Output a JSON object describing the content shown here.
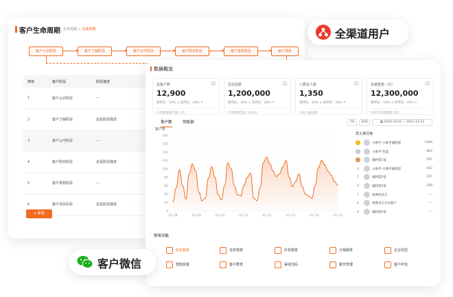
{
  "lifecycle": {
    "title": "客户生命周期",
    "breadcrumb_prefix": "生命周期 > ",
    "breadcrumb_current": "设置周期",
    "stages": [
      "客户认识阶段",
      "客户了解阶段",
      "客户认可阶段",
      "客户购买阶段",
      "客户复购阶段",
      "客户流失"
    ],
    "table_headers": [
      "排序",
      "客户阶段",
      "阶段描述"
    ],
    "rows": [
      {
        "order": "1",
        "stage": "客户认识阶段",
        "desc": "---"
      },
      {
        "order": "2",
        "stage": "客户了解阶段",
        "desc": "这是阶段描述"
      },
      {
        "order": "3",
        "stage": "客户认可阶段",
        "desc": "---"
      },
      {
        "order": "4",
        "stage": "客户购买阶段",
        "desc": "这是阶段描述"
      },
      {
        "order": "5",
        "stage": "客户复购阶段",
        "desc": "---"
      },
      {
        "order": "6",
        "stage": "客户流失阶段",
        "desc": "这是阶段描述"
      }
    ],
    "add_button": "+ 新增"
  },
  "overview": {
    "title": "数据概览",
    "stats": [
      {
        "label": "总客户数",
        "value": "12,900",
        "cmp_a": "周环比：10%",
        "cmp_b": "日环比：20%",
        "foot": "今日新增客户数 100"
      },
      {
        "label": "互动总数",
        "value": "1,200,000",
        "cmp_a": "周环比：10%",
        "cmp_b": "日环比：20%",
        "foot": "今日新增互动 10000"
      },
      {
        "label": "入群总人数",
        "value": "1,350",
        "cmp_a": "周环比：10%",
        "cmp_b": "日环比：20%",
        "foot": "今日入群总数"
      },
      {
        "label": "总销售额（元）",
        "value": "12,300,000",
        "cmp_a": "周环比：10%",
        "cmp_b": "日环比：20%",
        "foot": "今日订单销售额 100"
      }
    ],
    "tabs": [
      "客户数",
      "销售额"
    ],
    "controls": {
      "day": "7天",
      "month": "30天",
      "range": "2020-10-01 ~ 2021-12-31"
    },
    "rank_title": "员工排行榜",
    "rank": [
      {
        "no": "1",
        "name": "小易子-小易子福利官",
        "count": "1369"
      },
      {
        "no": "2",
        "name": "小易子-至品",
        "count": "905"
      },
      {
        "no": "3",
        "name": "福利官1号",
        "count": "597"
      },
      {
        "no": "4",
        "name": "小易子-小易子福利官",
        "count": "463"
      },
      {
        "no": "5",
        "name": "福利官2号",
        "count": "225"
      },
      {
        "no": "6",
        "name": "福利官3号",
        "count": "169"
      },
      {
        "no": "7",
        "name": "优秀的员工",
        "count": "---"
      },
      {
        "no": "8",
        "name": "优秀员工大头客户",
        "count": "---"
      },
      {
        "no": "9",
        "name": "福利官5号",
        "count": "---"
      }
    ],
    "functions_title": "常用功能",
    "functions": [
      "好友裂变",
      "任务裂变",
      "红包裂变",
      "分销裂变",
      "企业风控",
      "智能获客",
      "客户群发",
      "渠道活码",
      "聊天管理",
      "客户红包"
    ]
  },
  "chart_data": {
    "type": "area",
    "ylabel": "客户数",
    "x": [
      "01-08",
      "01-09",
      "01-10",
      "01-11",
      "01-12",
      "01-13",
      "01-14",
      "01-15"
    ],
    "yticks": [
      0,
      20,
      40,
      60,
      80,
      100,
      120,
      140,
      160,
      180
    ],
    "ylim": [
      0,
      180
    ],
    "series": [
      {
        "values": [
          22,
          55,
          98,
          60,
          28,
          88,
          112,
          95,
          45,
          24,
          30,
          78,
          105,
          80,
          38,
          26,
          60,
          115,
          100,
          60,
          38,
          36,
          60,
          80,
          90,
          30,
          24,
          56,
          115,
          128,
          112,
          95,
          82,
          88,
          105,
          120,
          80,
          58,
          70,
          88,
          58,
          40,
          35,
          30,
          60,
          102,
          120,
          110,
          95,
          85,
          70,
          62
        ]
      }
    ],
    "color": "#f26b21"
  },
  "badges": {
    "all_channel": "全渠道用户",
    "wechat": "客户微信"
  }
}
